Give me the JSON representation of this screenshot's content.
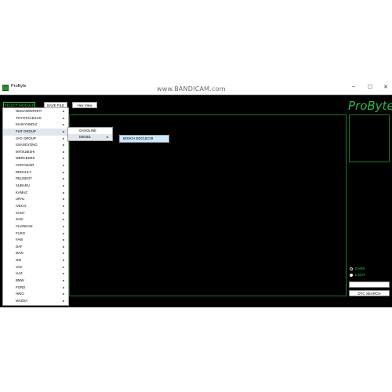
{
  "window": {
    "title": "ProByte",
    "watermark": "www.BANDICAM.com"
  },
  "window_controls": {
    "minimize": "–",
    "maximize": "☐",
    "close": "✕"
  },
  "toolbar": {
    "select_module": "SELECT MODULE",
    "save_file": "SAVE FILE",
    "hex_view": "Hex View"
  },
  "brand": "ProByte",
  "module_menu": [
    "NISSAN/INFINITI",
    "TOYOTA/LEXUS",
    "KIA/HYUNDAI",
    "FIAT GROUP",
    "VAG GROUP",
    "SSANGYONG",
    "MITSUBISHI",
    "MERCEDES",
    "CHRYSLER",
    "RENAULT",
    "PEUGEOT",
    "SUBARU",
    "KAMAZ",
    "URAL",
    "IVECO",
    "SANY",
    "SAIC",
    "CHANGAN",
    "FUSO",
    "FAW",
    "DAF",
    "MAN",
    "GM",
    "VAZ",
    "UAZ",
    "BMW",
    "FORD",
    "HINO",
    "MAZDA"
  ],
  "fiat_submenu": [
    "GASOLINE",
    "DIESEL"
  ],
  "diesel_submenu": [
    "BOSCH EDC16C39"
  ],
  "theme": {
    "dark": "DARK",
    "light": "LIGHT"
  },
  "dtc": {
    "input_value": "",
    "button": "DTC SEARCH"
  },
  "colors": {
    "accent_green": "#2ecc40",
    "highlight": "#cce8ff",
    "background": "#000000"
  }
}
